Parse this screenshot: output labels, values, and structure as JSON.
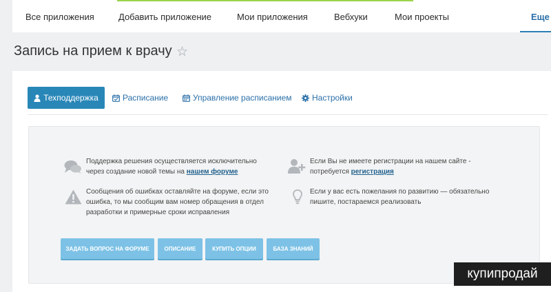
{
  "topnav": {
    "items": [
      {
        "label": "Все приложения"
      },
      {
        "label": "Добавить приложение"
      },
      {
        "label": "Мои приложения"
      },
      {
        "label": "Вебхуки"
      },
      {
        "label": "Мои проекты"
      }
    ],
    "more_label": "Еще",
    "more_caret": "▾"
  },
  "page": {
    "title": "Запись на прием к врачу",
    "star": "☆"
  },
  "tabs": [
    {
      "label": "Техподдержка",
      "icon": "user-icon",
      "active": true
    },
    {
      "label": "Расписание",
      "icon": "calendar-check-icon"
    },
    {
      "label": "Управление расписанием",
      "icon": "calendar-icon"
    },
    {
      "label": "Настройки",
      "icon": "gear-icon"
    }
  ],
  "support": {
    "forum": {
      "line1": "Поддержка решения осуществляется исключительно",
      "line2": "через создание новой темы на ",
      "link": "нашем форуме"
    },
    "register": {
      "line1": "Если Вы не имеете регистрации на нашем сайте -",
      "line2": "потребуется ",
      "link": "регистрация"
    },
    "errors": {
      "line1": "Сообщения об ошибках оставляйте на форуме, если это",
      "line2": "ошибка, то мы сообщим вам номер обращения в отдел",
      "line3": "разработки и примерные сроки исправления"
    },
    "wishes": {
      "line1": "Если у вас есть пожелания по развитию — обязательно",
      "line2": "пишите, постараемся реализовать"
    },
    "buttons": [
      {
        "label": "ЗАДАТЬ ВОПРОС НА ФОРУМЕ"
      },
      {
        "label": "ОПИСАНИЕ"
      },
      {
        "label": "КУПИТЬ ОПЦИИ"
      },
      {
        "label": "БАЗА ЗНАНИЙ"
      }
    ]
  },
  "watermark": "купипродай",
  "colors": {
    "accent": "#2987b8",
    "button": "#7dc2e6",
    "link": "#2a6fa8",
    "nav_highlight": "#9bd34a"
  }
}
